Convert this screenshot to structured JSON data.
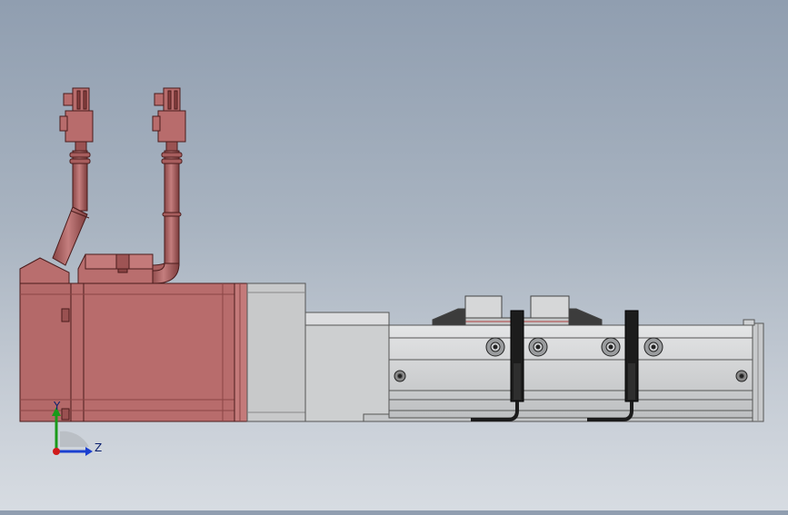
{
  "view": {
    "title": "",
    "background": {
      "top": "#909eb0",
      "bottom": "#d7dce2"
    }
  },
  "model": {
    "motor_color": "#b56a6a",
    "motor_dark": "#7a3838",
    "flange_color": "#c9c9c9",
    "body_color": "#d2d4d6",
    "sensor_color": "#1c1c1c",
    "connector_count": 2,
    "sensor_count": 2
  },
  "triad": {
    "y_label": "Y",
    "z_label": "Z",
    "y_color": "#1a9a1a",
    "z_color": "#1a3fd0",
    "origin_color": "#d01a1a"
  }
}
